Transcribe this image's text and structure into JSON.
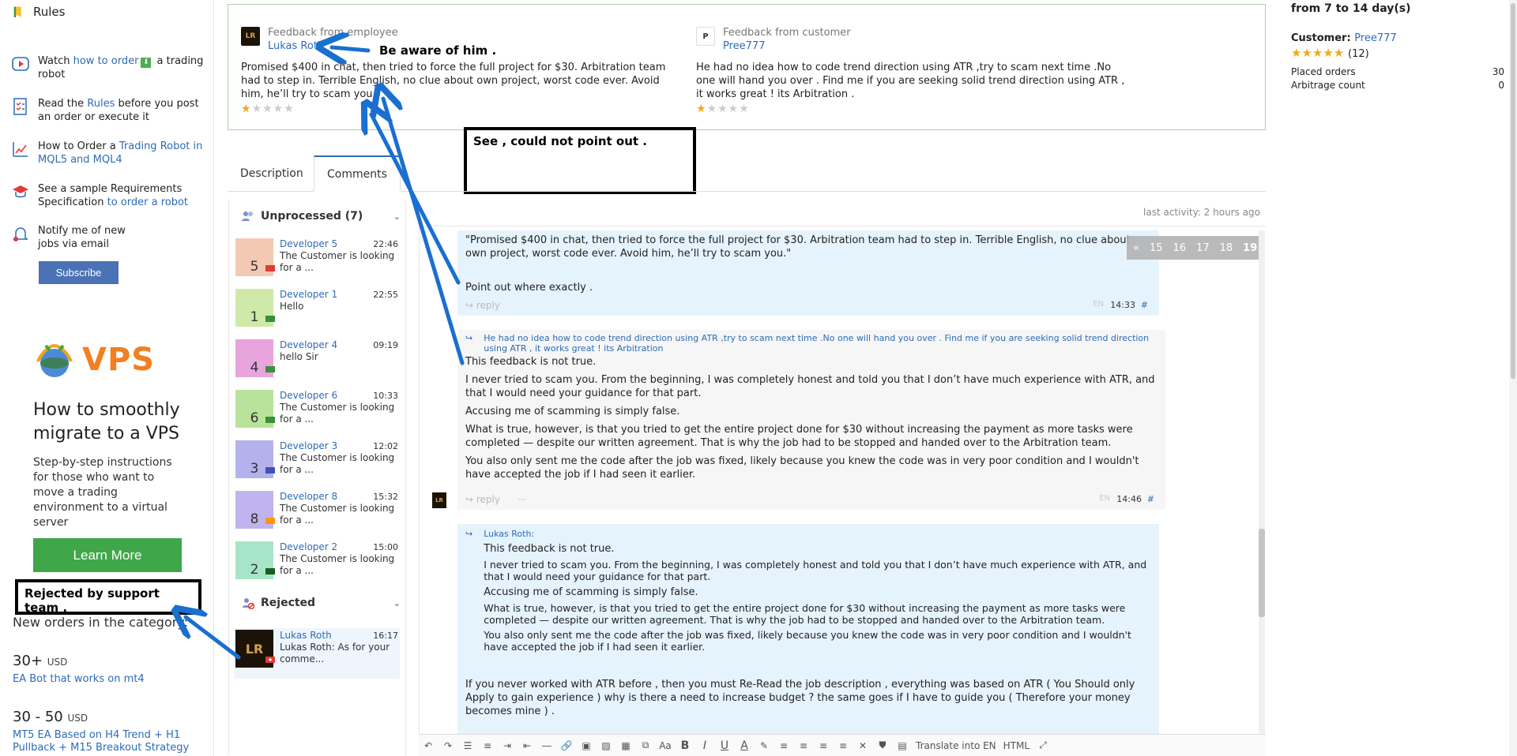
{
  "sidebar": {
    "rules_label": "Rules",
    "items": [
      {
        "prefix": "Watch ",
        "link": "how to order",
        "suffix": " a trading robot"
      },
      {
        "prefix": "Read the ",
        "link": "Rules",
        "suffix": " before you post an order or execute it"
      },
      {
        "prefix": "How to Order a ",
        "link": "Trading Robot in MQL5 and MQL4",
        "suffix": ""
      },
      {
        "prefix": "See a sample Requirements Specification ",
        "link": "to order a robot",
        "suffix": ""
      },
      {
        "prefix": "Notify me of new jobs via email",
        "link": "",
        "suffix": ""
      }
    ],
    "subscribe_label": "Subscribe",
    "vps_logo": "VPS",
    "vps_title": "How to smoothly migrate to a VPS",
    "vps_desc": "Step-by-step instructions for those who want to move a trading environment to a virtual server",
    "learn_more": "Learn More",
    "new_orders_label": "New orders in the category:",
    "orders": [
      {
        "price": "30+",
        "currency": "USD",
        "title": "EA Bot that works on mt4"
      },
      {
        "price": "30 - 50",
        "currency": "USD",
        "title": "MT5 EA Based on H4 Trend + H1 Pullback + M15 Breakout Strategy"
      }
    ]
  },
  "feedback": {
    "employee": {
      "label": "Feedback from employee",
      "avatar": "LR",
      "name": "Lukas Roth",
      "text": "Promised $400 in chat, then tried to force the full project for $30. Arbitration team had to step in. Terrible English, no clue about own project, worst code ever. Avoid him, he’ll try to scam you.",
      "rating": 1
    },
    "customer": {
      "label": "Feedback from customer",
      "avatar": "P",
      "name": "Pree777",
      "text": "He had no idea how to code trend direction using ATR ,try to scam next time .No one will hand you over . Find me if you are seeking solid trend direction using ATR , it works great ! its Arbitration .",
      "rating": 1
    }
  },
  "tabs": {
    "description": "Description",
    "comments": "Comments"
  },
  "chat": {
    "unprocessed_label": "Unprocessed (7)",
    "rejected_label": "Rejected",
    "items": [
      {
        "name": "Developer 5",
        "num": "5",
        "preview": "The Customer is looking for a ...",
        "time": "22:46",
        "bg": "#f3c9b4"
      },
      {
        "name": "Developer 1",
        "num": "1",
        "preview": "Hello",
        "time": "22:55",
        "bg": "#cfe9a8"
      },
      {
        "name": "Developer 4",
        "num": "4",
        "preview": "hello Sir",
        "time": "09:19",
        "bg": "#e8a4dc"
      },
      {
        "name": "Developer 6",
        "num": "6",
        "preview": "The Customer is looking for a ...",
        "time": "10:33",
        "bg": "#b9e39a"
      },
      {
        "name": "Developer 3",
        "num": "3",
        "preview": "The Customer is looking for a ...",
        "time": "12:02",
        "bg": "#b3b2ec"
      },
      {
        "name": "Developer 8",
        "num": "8",
        "preview": "The Customer is looking for a ...",
        "time": "15:32",
        "bg": "#c0b3ee"
      },
      {
        "name": "Developer 2",
        "num": "2",
        "preview": "The Customer is looking for a ...",
        "time": "15:00",
        "bg": "#a7e5c9"
      }
    ],
    "rejected": {
      "name": "Lukas Roth",
      "avatar": "LR",
      "preview": "Lukas Roth: As for your comme...",
      "time": "16:17"
    }
  },
  "conversation": {
    "last_activity": "last activity: 2 hours ago",
    "pages": [
      "«",
      "15",
      "16",
      "17",
      "18",
      "19"
    ],
    "msg1": {
      "quote": "\"Promised $400 in chat, then tried to force the full project for $30. Arbitration team had to step in. Terrible English, no clue about own project, worst code ever. Avoid him, he’ll try to scam you.\"",
      "text": "Point out where exactly .",
      "reply": "reply",
      "lang": "EN",
      "time": "14:33",
      "hash": "#"
    },
    "msg2": {
      "quote": "He had no idea how to code trend direction using ATR ,try to scam next time .No one will hand you over . Find me if you are seeking solid trend direction using ATR , it works great ! its Arbitration",
      "p1": "This feedback is not true.",
      "p2": "I never tried to scam you. From the beginning, I was completely honest and told you that I don’t have much experience with ATR, and that I would need your guidance for that part.",
      "p3": "Accusing me of scamming is simply false.",
      "p4": "What is true, however, is that you tried to get the entire project done for $30 without increasing the payment as more tasks were completed — despite our written agreement. That is why the job had to be stopped and handed over to the Arbitration team.",
      "p5": "You also only sent me the code after the job was fixed, likely because you knew the code was in very poor condition and I wouldn't have accepted the job if I had seen it earlier.",
      "reply": "reply",
      "more": "···",
      "lang": "EN",
      "time": "14:46",
      "hash": "#",
      "avatar": "LR"
    },
    "msg3": {
      "quote_author": "Lukas Roth:",
      "p1": "This feedback is not true.",
      "p2": "I never tried to scam you. From the beginning, I was completely honest and told you that I don’t have much experience with ATR, and that I would need your guidance for that part.",
      "p3": "Accusing me of scamming is simply false.",
      "p4": "What is true, however, is that you tried to get the entire project done for $30 without increasing the payment as more tasks were completed — despite our written agreement. That is why the job had to be stopped and handed over to the Arbitration team.",
      "p5": "You also only sent me the code after the job was fixed, likely because you knew the code was in very poor condition and I wouldn't have accepted the job if I had seen it earlier.",
      "text": "If you never worked with ATR before , then you must Re-Read the job description , everything was based on ATR ( You Should only Apply to gain experience ) why is there a need to increase budget ? the same goes if I have to guide you ( Therefore your money becomes mine ) ."
    }
  },
  "toolbar": {
    "font_size": "Aa",
    "bold": "B",
    "italic": "I",
    "underline": "U",
    "color": "A",
    "translate": "Translate into EN",
    "html": "HTML"
  },
  "right": {
    "days": "from 7 to 14 day(s)",
    "customer_label": "Customer:",
    "customer_name": "Pree777",
    "rating_count": "(12)",
    "placed_orders_label": "Placed orders",
    "placed_orders": "30",
    "arbitrage_label": "Arbitrage count",
    "arbitrage": "0"
  },
  "annotations": {
    "aware": "Be aware of him .",
    "point_out": "See , could not point out .",
    "rejected": "Rejected by support team ."
  },
  "colors": {
    "link": "#2c6bb8",
    "annotation_arrow": "#1a6fd0",
    "feedback_border": "#a9d5a4",
    "star": "#f0a81e",
    "learn_more": "#3fa64a",
    "subscribe": "#4a72b5",
    "vps": "#f08023"
  }
}
